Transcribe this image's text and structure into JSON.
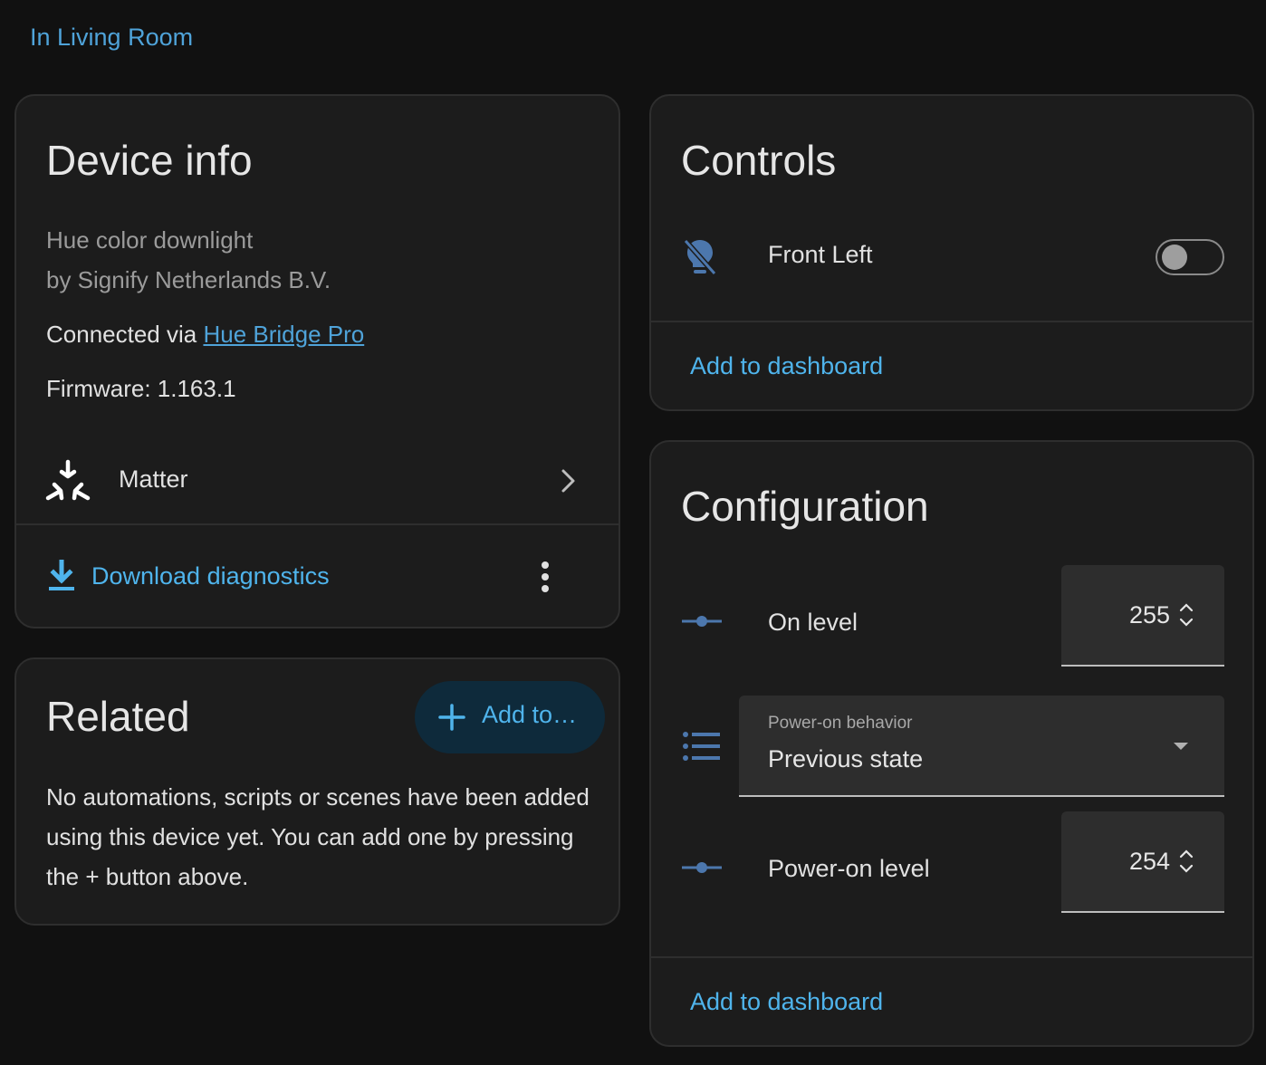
{
  "area_link": "In Living Room",
  "device_info": {
    "title": "Device info",
    "model": "Hue color downlight",
    "manufacturer": "by Signify Netherlands B.V.",
    "connected_prefix": "Connected via ",
    "connected_link": "Hue Bridge Pro",
    "firmware": "Firmware: 1.163.1",
    "integration": {
      "label": "Matter",
      "icon": "matter-icon"
    },
    "download_label": "Download diagnostics"
  },
  "related": {
    "title": "Related",
    "add_button": "Add to…",
    "empty_text": "No automations, scripts or scenes have been added using this device yet. You can add one by pressing the + button above."
  },
  "controls": {
    "title": "Controls",
    "entities": [
      {
        "label": "Front Left",
        "icon": "lightbulb-off-icon",
        "state": "off"
      }
    ],
    "add_to_dashboard": "Add to dashboard"
  },
  "configuration": {
    "title": "Configuration",
    "on_level": {
      "label": "On level",
      "value": "255",
      "icon": "slider-icon"
    },
    "power_on_behavior": {
      "field_label": "Power-on behavior",
      "value": "Previous state",
      "icon": "list-icon"
    },
    "power_on_level": {
      "label": "Power-on level",
      "value": "254",
      "icon": "slider-icon"
    },
    "add_to_dashboard": "Add to dashboard"
  },
  "colors": {
    "background": "#111111",
    "card": "#1c1c1c",
    "accent": "#4fb4ec",
    "icon_blue": "#4c77ad"
  }
}
